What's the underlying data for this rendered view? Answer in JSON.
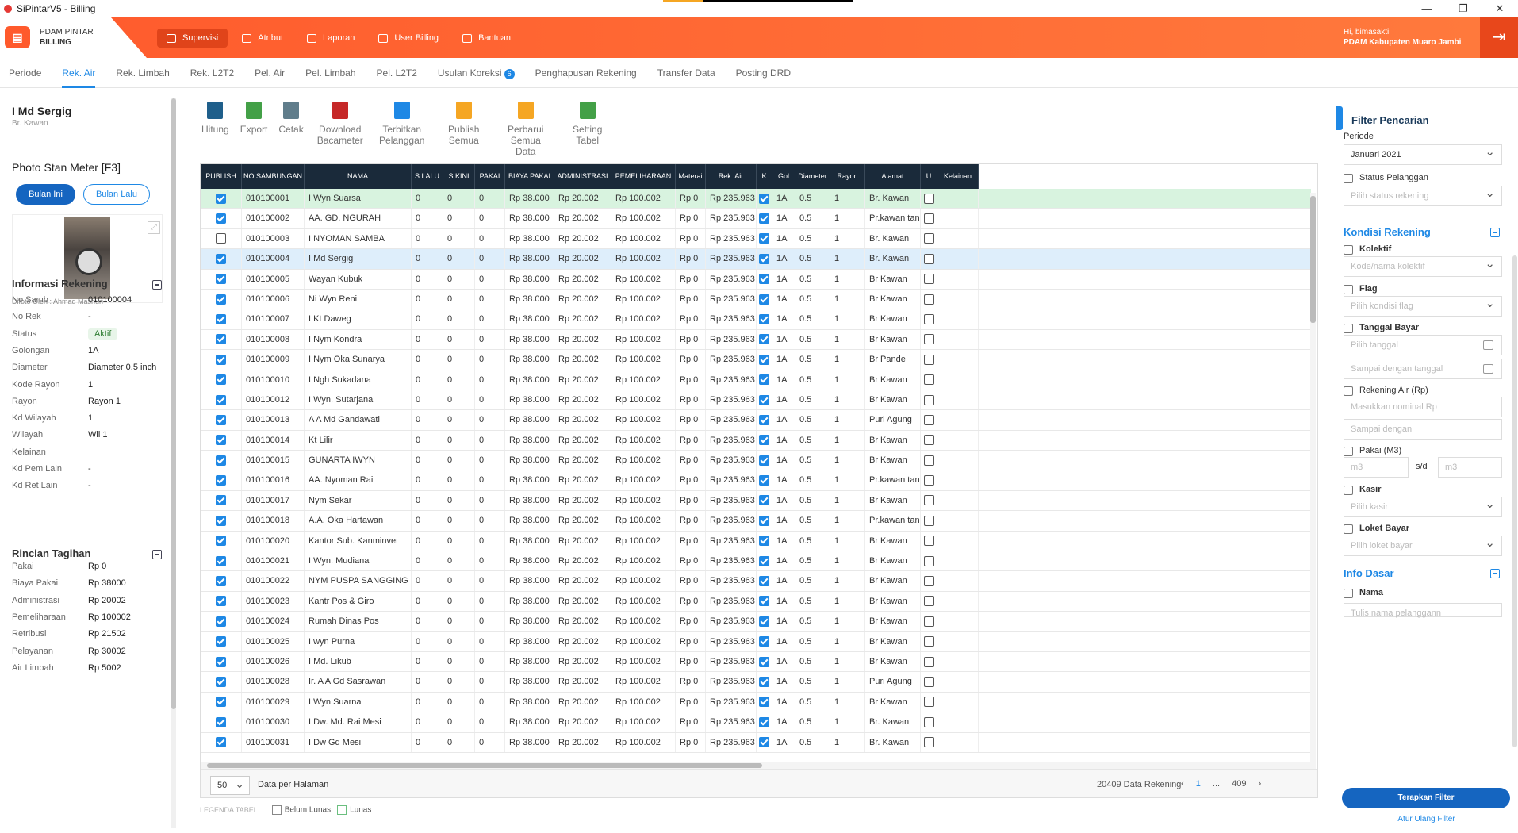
{
  "window": {
    "title": "SiPintarV5 - Billing",
    "min": "—",
    "max": "❐",
    "close": "✕"
  },
  "brand": {
    "line1": "PDAM PINTAR",
    "line2": "BILLING"
  },
  "nav": [
    {
      "label": "Supervisi",
      "icon": "briefcase-icon"
    },
    {
      "label": "Atribut",
      "icon": "tag-icon"
    },
    {
      "label": "Laporan",
      "icon": "chart-icon"
    },
    {
      "label": "User Billing",
      "icon": "users-icon"
    },
    {
      "label": "Bantuan",
      "icon": "chat-icon"
    }
  ],
  "user": {
    "greeting": "Hi, bimasakti",
    "org": "PDAM Kabupaten Muaro Jambi"
  },
  "subtabs": [
    "Periode",
    "Rek. Air",
    "Rek. Limbah",
    "Rek. L2T2",
    "Pel. Air",
    "Pel. Limbah",
    "Pel. L2T2",
    "Usulan Koreksi",
    "Penghapusan Rekening",
    "Transfer Data",
    "Posting DRD"
  ],
  "usulan_badge": "6",
  "customer": {
    "name": "I Md Sergig",
    "address": "Br. Kawan"
  },
  "photo": {
    "title": "Photo Stan Meter [F3]",
    "btn_this": "Bulan Ini",
    "btn_last": "Bulan Lalu",
    "by": "Difoto Oleh : Ahmad Mashuri"
  },
  "info": {
    "title": "Informasi Rekening",
    "rows": [
      {
        "k": "No Samb",
        "v": "010100004"
      },
      {
        "k": "No Rek",
        "v": "-"
      },
      {
        "k": "Status",
        "v": "Aktif"
      },
      {
        "k": "Golongan",
        "v": "1A"
      },
      {
        "k": "Diameter",
        "v": "Diameter 0.5 inch"
      },
      {
        "k": "Kode Rayon",
        "v": "1"
      },
      {
        "k": "Rayon",
        "v": "Rayon 1"
      },
      {
        "k": "Kd Wilayah",
        "v": "1"
      },
      {
        "k": "Wilayah",
        "v": "Wil 1"
      },
      {
        "k": "Kelainan",
        "v": ""
      },
      {
        "k": "Kd Pem Lain",
        "v": "-"
      },
      {
        "k": "Kd Ret Lain",
        "v": "-"
      }
    ]
  },
  "rincian": {
    "title": "Rincian Tagihan",
    "rows": [
      {
        "k": "Pakai",
        "v": "Rp 0"
      },
      {
        "k": "Biaya Pakai",
        "v": "Rp 38000"
      },
      {
        "k": "Administrasi",
        "v": "Rp 20002"
      },
      {
        "k": "Pemeliharaan",
        "v": "Rp 100002"
      },
      {
        "k": "Retribusi",
        "v": "Rp 21502"
      },
      {
        "k": "Pelayanan",
        "v": "Rp 30002"
      },
      {
        "k": "Air Limbah",
        "v": "Rp 5002"
      }
    ]
  },
  "toolbar": [
    {
      "label": "Hitung",
      "icon": "calculator-icon",
      "color": "#1f5f8b"
    },
    {
      "label": "Export",
      "icon": "spreadsheet-icon",
      "color": "#43a047"
    },
    {
      "label": "Cetak",
      "icon": "printer-icon",
      "color": "#607d8b"
    },
    {
      "label": "Download Bacameter",
      "icon": "download-icon",
      "color": "#c62828"
    },
    {
      "label": "Terbitkan Pelanggan",
      "icon": "document-icon",
      "color": "#1e88e5"
    },
    {
      "label": "Publish Semua",
      "icon": "upload-icon",
      "color": "#f5a623"
    },
    {
      "label": "Perbarui Semua Data",
      "icon": "refresh-doc-icon",
      "color": "#f5a623"
    },
    {
      "label": "Setting Tabel",
      "icon": "settings-table-icon",
      "color": "#43a047"
    }
  ],
  "columns": [
    "PUBLISH",
    "NO SAMBUNGAN",
    "NAMA",
    "S LALU",
    "S KINI",
    "PAKAI",
    "BIAYA PAKAI",
    "ADMINISTRASI",
    "PEMELIHARAAN",
    "Materai",
    "Rek. Air",
    "K",
    "Gol",
    "Diameter",
    "Rayon",
    "Alamat",
    "U",
    "Kelainan"
  ],
  "rows": [
    {
      "pub": true,
      "no": "010100001",
      "nama": "I Wyn Suarsa",
      "alamat": "Br. Kawan",
      "hl": "green"
    },
    {
      "pub": true,
      "no": "010100002",
      "nama": "AA. GD. NGURAH",
      "alamat": "Pr.kawan tanggu",
      "hl": ""
    },
    {
      "pub": false,
      "no": "010100003",
      "nama": "I NYOMAN SAMBA",
      "alamat": "Br. Kawan",
      "hl": ""
    },
    {
      "pub": true,
      "no": "010100004",
      "nama": "I Md Sergig",
      "alamat": "Br. Kawan",
      "hl": "blue"
    },
    {
      "pub": true,
      "no": "010100005",
      "nama": "Wayan Kubuk",
      "alamat": "Br Kawan",
      "hl": ""
    },
    {
      "pub": true,
      "no": "010100006",
      "nama": "Ni Wyn Reni",
      "alamat": "Br Kawan",
      "hl": ""
    },
    {
      "pub": true,
      "no": "010100007",
      "nama": "I Kt Daweg",
      "alamat": "Br Kawan",
      "hl": ""
    },
    {
      "pub": true,
      "no": "010100008",
      "nama": "I Nym Kondra",
      "alamat": "Br Kawan",
      "hl": ""
    },
    {
      "pub": true,
      "no": "010100009",
      "nama": "I Nym Oka Sunarya",
      "alamat": "Br Pande",
      "hl": ""
    },
    {
      "pub": true,
      "no": "010100010",
      "nama": "I Ngh Sukadana",
      "alamat": "Br Kawan",
      "hl": ""
    },
    {
      "pub": true,
      "no": "010100012",
      "nama": "I Wyn. Sutarjana",
      "alamat": "Br Kawan",
      "hl": ""
    },
    {
      "pub": true,
      "no": "010100013",
      "nama": "A A Md Gandawati",
      "alamat": "Puri Agung",
      "hl": ""
    },
    {
      "pub": true,
      "no": "010100014",
      "nama": "Kt Lilir",
      "alamat": "Br Kawan",
      "hl": ""
    },
    {
      "pub": true,
      "no": "010100015",
      "nama": "GUNARTA IWYN",
      "alamat": "Br Kawan",
      "hl": ""
    },
    {
      "pub": true,
      "no": "010100016",
      "nama": "AA. Nyoman Rai",
      "alamat": "Pr.kawan tanggu",
      "hl": ""
    },
    {
      "pub": true,
      "no": "010100017",
      "nama": "Nym Sekar",
      "alamat": "Br Kawan",
      "hl": ""
    },
    {
      "pub": true,
      "no": "010100018",
      "nama": "A.A. Oka Hartawan",
      "alamat": "Pr.kawan tanggu",
      "hl": ""
    },
    {
      "pub": true,
      "no": "010100020",
      "nama": "Kantor  Sub. Kanminvet",
      "alamat": "Br Kawan",
      "hl": ""
    },
    {
      "pub": true,
      "no": "010100021",
      "nama": "I Wyn. Mudiana",
      "alamat": "Br Kawan",
      "hl": ""
    },
    {
      "pub": true,
      "no": "010100022",
      "nama": "NYM PUSPA SANGGING",
      "alamat": "Br Kawan",
      "hl": ""
    },
    {
      "pub": true,
      "no": "010100023",
      "nama": "Kantr Pos & Giro",
      "alamat": "Br Kawan",
      "hl": ""
    },
    {
      "pub": true,
      "no": "010100024",
      "nama": "Rumah Dinas Pos",
      "alamat": "Br Kawan",
      "hl": ""
    },
    {
      "pub": true,
      "no": "010100025",
      "nama": "I wyn Purna",
      "alamat": "Br Kawan",
      "hl": ""
    },
    {
      "pub": true,
      "no": "010100026",
      "nama": "I Md. Likub",
      "alamat": "Br Kawan",
      "hl": ""
    },
    {
      "pub": true,
      "no": "010100028",
      "nama": "Ir. A A Gd Sasrawan",
      "alamat": "Puri Agung",
      "hl": ""
    },
    {
      "pub": true,
      "no": "010100029",
      "nama": "I Wyn Suarna",
      "alamat": "Br Kawan",
      "hl": ""
    },
    {
      "pub": true,
      "no": "010100030",
      "nama": "I Dw. Md. Rai Mesi",
      "alamat": "Br. Kawan",
      "hl": ""
    },
    {
      "pub": true,
      "no": "010100031",
      "nama": "I Dw Gd Mesi",
      "alamat": "Br. Kawan",
      "hl": ""
    }
  ],
  "row_common": {
    "slalu": "0",
    "skini": "0",
    "pakai": "0",
    "biaya": "Rp 38.000",
    "admin": "Rp 20.002",
    "pemel": "Rp 100.002",
    "materai": "Rp 0",
    "rekair": "Rp 235.963",
    "gol": "1A",
    "diam": "0.5",
    "rayon": "1"
  },
  "pager": {
    "per_page": "50",
    "per_page_label": "Data per Halaman",
    "total": "20409 Data Rekening",
    "prev": "‹",
    "p1": "1",
    "dots": "...",
    "last": "409",
    "next": "›"
  },
  "legend": {
    "title": "LEGENDA TABEL",
    "unpaid": "Belum Lunas",
    "paid": "Lunas"
  },
  "filter": {
    "title": "Filter Pencarian",
    "periode_label": "Periode",
    "periode_value": "Januari 2021",
    "status_label": "Status Pelanggan",
    "status_ph": "Pilih status rekening",
    "kondisi_title": "Kondisi Rekening",
    "kolektif_label": "Kolektif",
    "kolektif_ph": "Kode/nama kolektif",
    "flag_label": "Flag",
    "flag_ph": "Pilih kondisi flag",
    "tgl_label": "Tanggal Bayar",
    "tgl_ph": "Pilih tanggal",
    "tgl2_ph": "Sampai dengan tanggal",
    "rek_label": "Rekening Air (Rp)",
    "rek_ph": "Masukkan nominal Rp",
    "rek2_ph": "Sampai dengan",
    "pakai_label": "Pakai (M3)",
    "m3a": "m3",
    "sd": "s/d",
    "m3b": "m3",
    "kasir_label": "Kasir",
    "kasir_ph": "Pilih kasir",
    "loket_label": "Loket Bayar",
    "loket_ph": "Pilih loket bayar",
    "info_title": "Info Dasar",
    "nama_label": "Nama",
    "nama_ph": "Tulis nama pelanggann",
    "apply": "Terapkan Filter",
    "reset": "Atur Ulang Filter"
  }
}
